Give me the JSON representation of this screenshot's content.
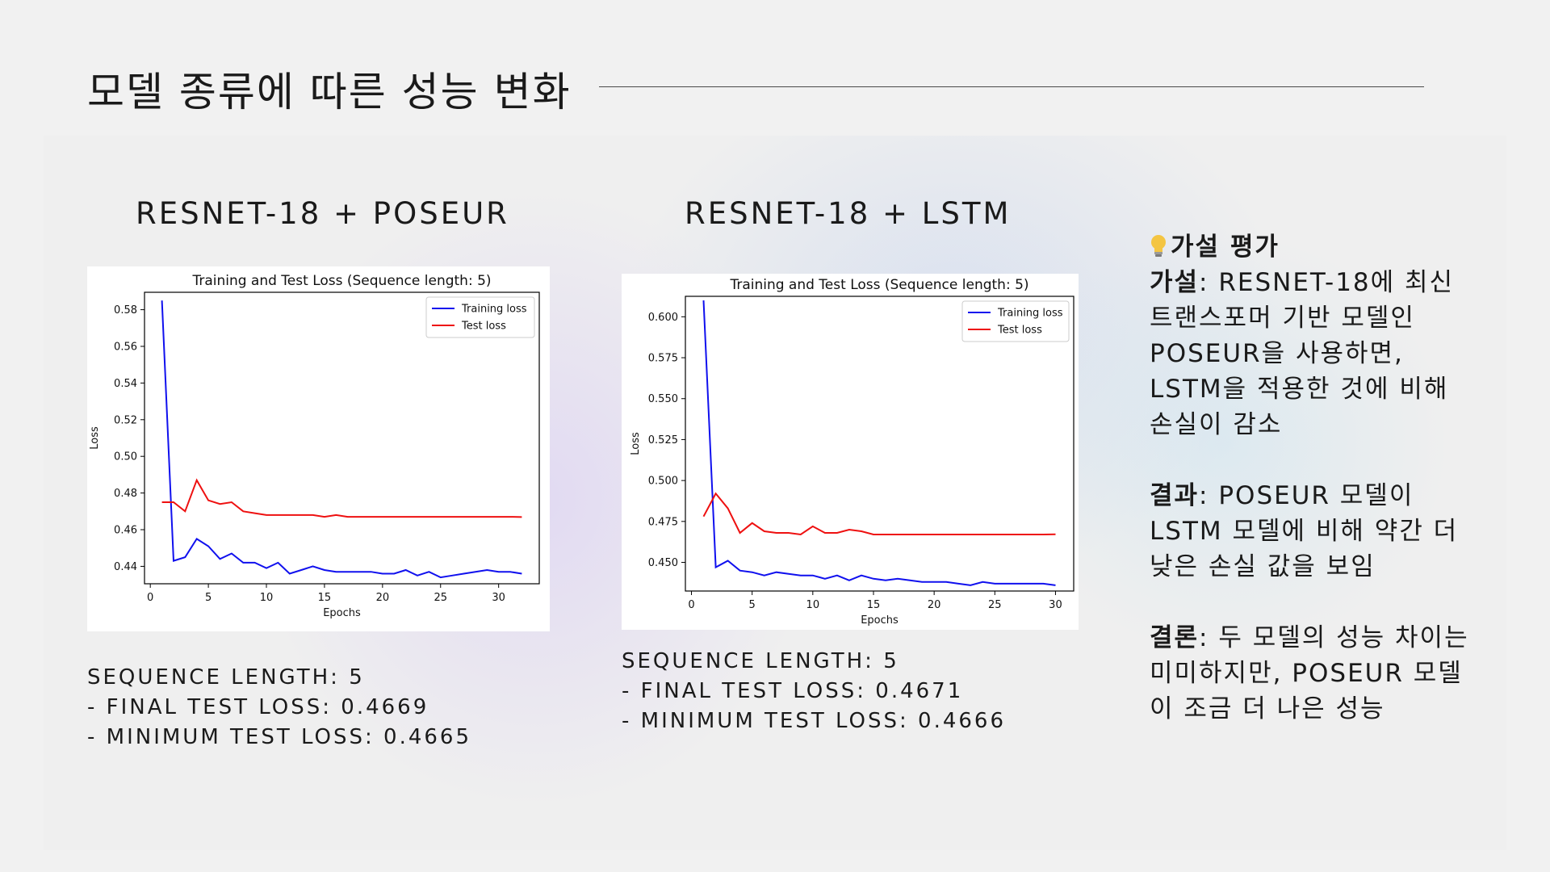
{
  "slide": {
    "title": "모델 종류에 따른 성능 변화"
  },
  "left": {
    "heading": "RESNET-18 + POSEUR",
    "stats": [
      "SEQUENCE LENGTH: 5",
      "- FINAL TEST LOSS: 0.4669",
      "- MINIMUM TEST LOSS: 0.4665"
    ]
  },
  "middle": {
    "heading": "RESNET-18 + LSTM",
    "stats": [
      "SEQUENCE LENGTH: 5",
      "- FINAL TEST LOSS: 0.4671",
      "- MINIMUM TEST LOSS: 0.4666"
    ]
  },
  "hypothesis": {
    "icon": "lightbulb-icon",
    "heading": "가설 평가",
    "hypothesis_label": "가설",
    "hypothesis_text": ": RESNET-18에 최신 트랜스포머 기반 모델인 POSEUR을 사용하면, LSTM을 적용한 것에 비해 손실이 감소",
    "result_label": "결과",
    "result_text": ": POSEUR 모델이 LSTM 모델에 비해 약간 더 낮은 손실 값을 보임",
    "conclusion_label": "결론",
    "conclusion_text": ": 두 모델의 성능 차이는 미미하지만, POSEUR 모델이 조금 더 나은 성능"
  },
  "chart_data": [
    {
      "type": "line",
      "title": "Training and Test Loss (Sequence length: 5)",
      "xlabel": "Epochs",
      "ylabel": "Loss",
      "xlim": [
        -0.5,
        33.5
      ],
      "ylim": [
        0.4305,
        0.5895
      ],
      "xticks": [
        0,
        5,
        10,
        15,
        20,
        25,
        30
      ],
      "yticks": [
        0.44,
        0.46,
        0.48,
        0.5,
        0.52,
        0.54,
        0.56,
        0.58
      ],
      "ytick_decimals": 2,
      "legend": "top-right",
      "x": [
        1,
        2,
        3,
        4,
        5,
        6,
        7,
        8,
        9,
        10,
        11,
        12,
        13,
        14,
        15,
        16,
        17,
        18,
        19,
        20,
        21,
        22,
        23,
        24,
        25,
        26,
        27,
        28,
        29,
        30,
        31,
        32
      ],
      "series": [
        {
          "name": "Training loss",
          "color": "#1010ee",
          "values": [
            0.585,
            0.443,
            0.445,
            0.455,
            0.451,
            0.444,
            0.447,
            0.442,
            0.442,
            0.439,
            0.442,
            0.436,
            0.438,
            0.44,
            0.438,
            0.437,
            0.437,
            0.437,
            0.437,
            0.436,
            0.436,
            0.438,
            0.435,
            0.437,
            0.434,
            0.435,
            0.436,
            0.437,
            0.438,
            0.437,
            0.437,
            0.436
          ]
        },
        {
          "name": "Test loss",
          "color": "#ee1010",
          "values": [
            0.475,
            0.475,
            0.47,
            0.487,
            0.476,
            0.474,
            0.475,
            0.47,
            0.469,
            0.468,
            0.468,
            0.468,
            0.468,
            0.468,
            0.467,
            0.468,
            0.467,
            0.467,
            0.467,
            0.467,
            0.467,
            0.467,
            0.467,
            0.467,
            0.467,
            0.467,
            0.467,
            0.467,
            0.467,
            0.467,
            0.467,
            0.4669
          ]
        }
      ]
    },
    {
      "type": "line",
      "title": "Training and Test Loss (Sequence length: 5)",
      "xlabel": "Epochs",
      "ylabel": "Loss",
      "xlim": [
        -0.5,
        31.5
      ],
      "ylim": [
        0.4325,
        0.6125
      ],
      "xticks": [
        0,
        5,
        10,
        15,
        20,
        25,
        30
      ],
      "yticks": [
        0.45,
        0.475,
        0.5,
        0.525,
        0.55,
        0.575,
        0.6
      ],
      "ytick_decimals": 3,
      "legend": "top-right",
      "x": [
        1,
        2,
        3,
        4,
        5,
        6,
        7,
        8,
        9,
        10,
        11,
        12,
        13,
        14,
        15,
        16,
        17,
        18,
        19,
        20,
        21,
        22,
        23,
        24,
        25,
        26,
        27,
        28,
        29,
        30
      ],
      "series": [
        {
          "name": "Training loss",
          "color": "#1010ee",
          "values": [
            0.61,
            0.447,
            0.451,
            0.445,
            0.444,
            0.442,
            0.444,
            0.443,
            0.442,
            0.442,
            0.44,
            0.442,
            0.439,
            0.442,
            0.44,
            0.439,
            0.44,
            0.439,
            0.438,
            0.438,
            0.438,
            0.437,
            0.436,
            0.438,
            0.437,
            0.437,
            0.437,
            0.437,
            0.437,
            0.436
          ]
        },
        {
          "name": "Test loss",
          "color": "#ee1010",
          "values": [
            0.478,
            0.492,
            0.483,
            0.468,
            0.474,
            0.469,
            0.468,
            0.468,
            0.467,
            0.472,
            0.468,
            0.468,
            0.47,
            0.469,
            0.467,
            0.467,
            0.467,
            0.467,
            0.467,
            0.467,
            0.467,
            0.467,
            0.467,
            0.467,
            0.467,
            0.467,
            0.467,
            0.467,
            0.467,
            0.4671
          ]
        }
      ]
    }
  ]
}
